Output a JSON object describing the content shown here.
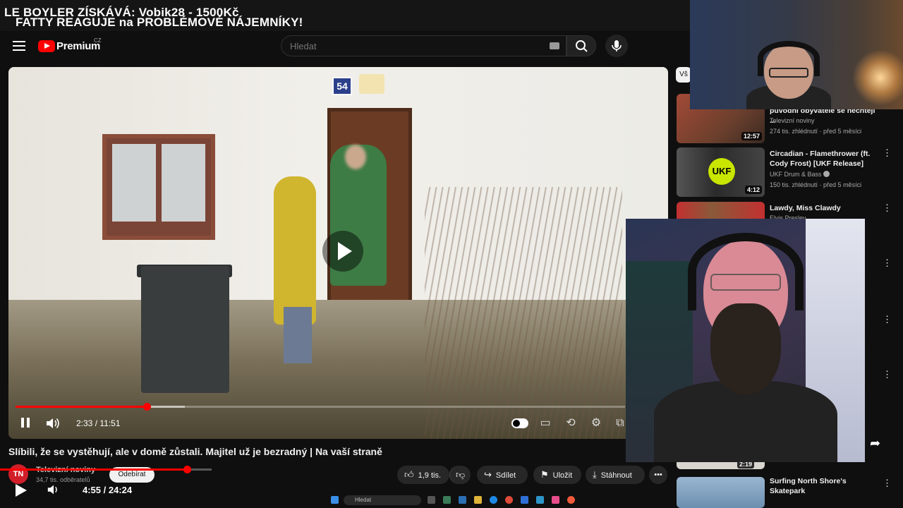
{
  "overlay": {
    "line1": "LE BOYLER ZÍSKÁVÁ: Vobik28 - 1500Kč",
    "line2": "FATTY REAGUJE na PROBLÉMOVÉ NÁJEMNÍKY!"
  },
  "masthead": {
    "logo_text": "Premium",
    "logo_country": "CZ",
    "search_placeholder": "Hledat"
  },
  "video": {
    "house_number": "54",
    "current_time": "2:33",
    "duration": "11:51",
    "time_display": "2:33 / 11:51",
    "progress_fraction": 0.215,
    "title": "Slíbili, že se vystěhují, ale v domě zůstali. Majitel už je bezradný | Na vaší straně",
    "channel": {
      "avatar_text": "TN",
      "name": "Televizní noviny",
      "subscribers": "34,7 tis. odběratelů",
      "subscribe_label": "Odebírat"
    },
    "actions": {
      "likes": "1,9 tis.",
      "share": "Sdílet",
      "save": "Uložit",
      "download": "Stáhnout"
    }
  },
  "stream_player": {
    "time_display": "4:55 / 24:24",
    "progress_fraction": 0.2
  },
  "taskbar": {
    "search_placeholder": "Hledat"
  },
  "sidebar": {
    "chip_label": "Vš",
    "items": [
      {
        "title": "původní obyvatelé se nechtějí ...",
        "channel": "Televizní noviny",
        "meta": "274 tis. zhlédnutí · před 5 měsíci",
        "duration": "12:57",
        "thumb_color": "#7a3b2e"
      },
      {
        "title": "Circadian - Flamethrower (ft. Cody Frost) [UKF Release]",
        "channel": "UKF Drum & Bass",
        "meta": "150 tis. zhlédnutí · před 5 měsíci",
        "duration": "4:12",
        "thumb_color": "#3b3b3b",
        "thumb_badge": "UKF"
      },
      {
        "title": "Lawdy, Miss Clawdy",
        "channel": "Elvis Presley",
        "meta": "",
        "duration": "",
        "thumb_color": "#8a5a3a"
      },
      {
        "title": "Surfing North Shore's Skatepark",
        "channel": "",
        "meta": "",
        "duration": "2:19",
        "thumb_color": "#6c8fb0"
      }
    ]
  },
  "colors": {
    "background": "#0f0f0f",
    "accent_red": "#ff0000",
    "pill_bg": "#272727",
    "text_primary": "#f1f1f1",
    "text_secondary": "#aaaaaa"
  }
}
